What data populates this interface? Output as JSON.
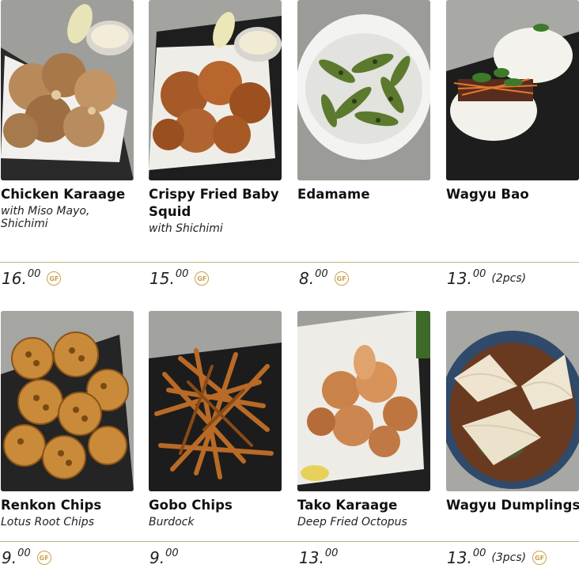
{
  "items": [
    {
      "name": "Chicken Karaage",
      "desc": "with Miso Mayo, Shichimi",
      "price_main": "16.",
      "price_cents": "00",
      "note": "",
      "gf": "GF"
    },
    {
      "name": "Crispy Fried Baby Squid",
      "desc": "with Shichimi",
      "price_main": "15.",
      "price_cents": "00",
      "note": "",
      "gf": "GF"
    },
    {
      "name": "Edamame",
      "desc": "",
      "price_main": "8.",
      "price_cents": "00",
      "note": "",
      "gf": "GF"
    },
    {
      "name": "Wagyu Bao",
      "desc": "",
      "price_main": "13.",
      "price_cents": "00",
      "note": "(2pcs)",
      "gf": ""
    },
    {
      "name": "Renkon Chips",
      "desc": "Lotus Root Chips",
      "price_main": "9.",
      "price_cents": "00",
      "note": "",
      "gf": "GF"
    },
    {
      "name": "Gobo Chips",
      "desc": "Burdock",
      "price_main": "9.",
      "price_cents": "00",
      "note": "",
      "gf": ""
    },
    {
      "name": "Tako Karaage",
      "desc": "Deep Fried Octopus",
      "price_main": "13.",
      "price_cents": "00",
      "note": "",
      "gf": ""
    },
    {
      "name": "Wagyu Dumplings",
      "desc": "",
      "price_main": "13.",
      "price_cents": "00",
      "note": "(3pcs)",
      "gf": "GF"
    }
  ],
  "colors": {
    "accent_rule": "#bdb87a",
    "gf_badge": "#c9a24a",
    "background": "#ffffff"
  },
  "icons": [
    "gluten-free-badge-icon"
  ]
}
